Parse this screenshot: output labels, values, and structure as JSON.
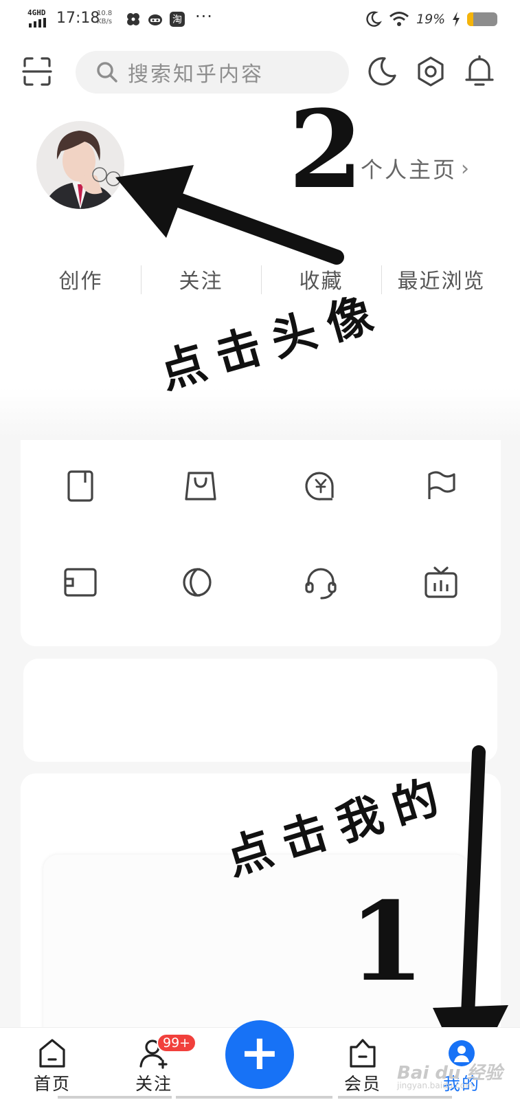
{
  "status_bar": {
    "network": "4GHD",
    "time": "17:18",
    "speed_value": "10.8",
    "speed_unit": "KB/s",
    "more": "···",
    "battery_percent": "19%",
    "battery_level": 0.19,
    "icons": [
      "fan-icon",
      "cat-app-icon",
      "taobao-icon",
      "moon-icon",
      "wifi-icon",
      "charging-icon"
    ]
  },
  "header": {
    "search_placeholder": "搜索知乎内容",
    "icons": [
      "scan-icon",
      "search-icon",
      "theme-moon-icon",
      "settings-icon",
      "bell-icon"
    ]
  },
  "profile": {
    "homepage_link": "个人主页",
    "chevron": "›",
    "quick_links": [
      "创作",
      "关注",
      "收藏",
      "最近浏览"
    ]
  },
  "tools": {
    "icons": [
      "book-icon",
      "shopping-bag-icon",
      "yuan-coin-icon",
      "flag-icon",
      "card-icon",
      "leaf-icon",
      "headset-icon",
      "tv-icon"
    ]
  },
  "annotations": {
    "step2_number": "2",
    "step2_text": "点击头像",
    "step1_number": "1",
    "step1_text": "点击我的"
  },
  "tabbar": {
    "tabs": [
      {
        "label": "首页",
        "icon": "home-icon"
      },
      {
        "label": "关注",
        "icon": "follow-icon",
        "badge": "99+"
      },
      {
        "label": "会员",
        "icon": "vip-icon"
      },
      {
        "label": "我的",
        "icon": "profile-icon"
      }
    ],
    "active": "我的",
    "add_label": "+"
  },
  "watermark": {
    "text": "Bai du 经验",
    "sub": "jingyan.baidu.com"
  },
  "colors": {
    "accent": "#1772f6",
    "badge": "#f1403c",
    "battery": "#f5b40a"
  }
}
